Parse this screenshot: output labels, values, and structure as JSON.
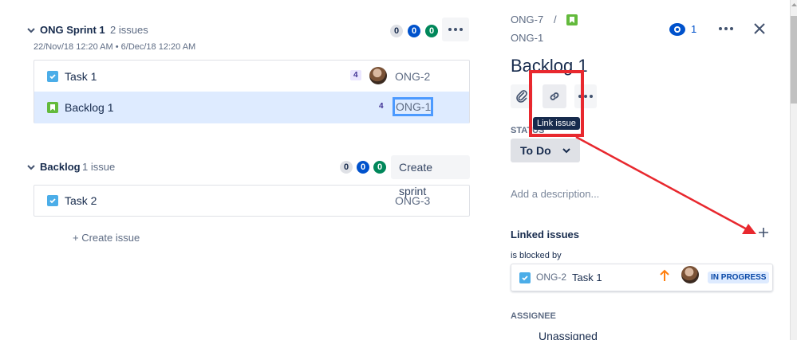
{
  "sprint": {
    "title": "ONG Sprint 1",
    "count": "2 issues",
    "dates": "22/Nov/18 12:20 AM • 6/Dec/18 12:20 AM",
    "pills": [
      "0",
      "0",
      "0"
    ],
    "issues": [
      {
        "summary": "Task 1",
        "estimate": "4",
        "key": "ONG-2",
        "type": "task"
      },
      {
        "summary": "Backlog 1",
        "estimate": "4",
        "key": "ONG-1",
        "type": "story"
      }
    ]
  },
  "backlog": {
    "title": "Backlog",
    "count": "1 issue",
    "pills": [
      "0",
      "0",
      "0"
    ],
    "create_sprint": "Create sprint",
    "issues": [
      {
        "summary": "Task 2",
        "key": "ONG-3",
        "type": "task"
      }
    ],
    "create_issue": "+ Create issue"
  },
  "detail": {
    "parent_key": "ONG-7",
    "separator": "/",
    "issue_key": "ONG-1",
    "watch_count": "1",
    "title": "Backlog 1",
    "tooltip": "Link issue",
    "status_label": "STATUS",
    "status_value": "To Do",
    "description_placeholder": "Add a description...",
    "linked_title": "Linked issues",
    "relation": "is blocked by",
    "linked": {
      "key": "ONG-2",
      "summary": "Task 1",
      "status": "IN PROGRESS"
    },
    "assignee_label": "ASSIGNEE",
    "assignee_value": "Unassigned"
  },
  "colors": {
    "accent": "#0052cc",
    "annotation": "#e8282e",
    "selected_row": "#deebff"
  }
}
